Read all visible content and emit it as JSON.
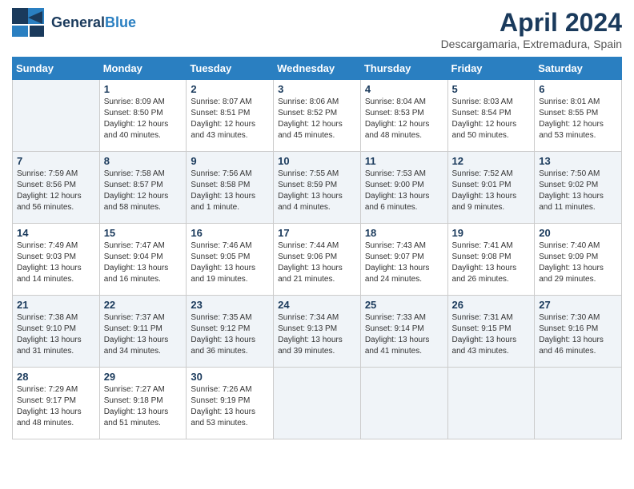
{
  "header": {
    "logo_general": "General",
    "logo_blue": "Blue",
    "title": "April 2024",
    "subtitle": "Descargamaria, Extremadura, Spain"
  },
  "columns": [
    "Sunday",
    "Monday",
    "Tuesday",
    "Wednesday",
    "Thursday",
    "Friday",
    "Saturday"
  ],
  "weeks": [
    [
      {
        "day": "",
        "sunrise": "",
        "sunset": "",
        "daylight": ""
      },
      {
        "day": "1",
        "sunrise": "Sunrise: 8:09 AM",
        "sunset": "Sunset: 8:50 PM",
        "daylight": "Daylight: 12 hours and 40 minutes."
      },
      {
        "day": "2",
        "sunrise": "Sunrise: 8:07 AM",
        "sunset": "Sunset: 8:51 PM",
        "daylight": "Daylight: 12 hours and 43 minutes."
      },
      {
        "day": "3",
        "sunrise": "Sunrise: 8:06 AM",
        "sunset": "Sunset: 8:52 PM",
        "daylight": "Daylight: 12 hours and 45 minutes."
      },
      {
        "day": "4",
        "sunrise": "Sunrise: 8:04 AM",
        "sunset": "Sunset: 8:53 PM",
        "daylight": "Daylight: 12 hours and 48 minutes."
      },
      {
        "day": "5",
        "sunrise": "Sunrise: 8:03 AM",
        "sunset": "Sunset: 8:54 PM",
        "daylight": "Daylight: 12 hours and 50 minutes."
      },
      {
        "day": "6",
        "sunrise": "Sunrise: 8:01 AM",
        "sunset": "Sunset: 8:55 PM",
        "daylight": "Daylight: 12 hours and 53 minutes."
      }
    ],
    [
      {
        "day": "7",
        "sunrise": "Sunrise: 7:59 AM",
        "sunset": "Sunset: 8:56 PM",
        "daylight": "Daylight: 12 hours and 56 minutes."
      },
      {
        "day": "8",
        "sunrise": "Sunrise: 7:58 AM",
        "sunset": "Sunset: 8:57 PM",
        "daylight": "Daylight: 12 hours and 58 minutes."
      },
      {
        "day": "9",
        "sunrise": "Sunrise: 7:56 AM",
        "sunset": "Sunset: 8:58 PM",
        "daylight": "Daylight: 13 hours and 1 minute."
      },
      {
        "day": "10",
        "sunrise": "Sunrise: 7:55 AM",
        "sunset": "Sunset: 8:59 PM",
        "daylight": "Daylight: 13 hours and 4 minutes."
      },
      {
        "day": "11",
        "sunrise": "Sunrise: 7:53 AM",
        "sunset": "Sunset: 9:00 PM",
        "daylight": "Daylight: 13 hours and 6 minutes."
      },
      {
        "day": "12",
        "sunrise": "Sunrise: 7:52 AM",
        "sunset": "Sunset: 9:01 PM",
        "daylight": "Daylight: 13 hours and 9 minutes."
      },
      {
        "day": "13",
        "sunrise": "Sunrise: 7:50 AM",
        "sunset": "Sunset: 9:02 PM",
        "daylight": "Daylight: 13 hours and 11 minutes."
      }
    ],
    [
      {
        "day": "14",
        "sunrise": "Sunrise: 7:49 AM",
        "sunset": "Sunset: 9:03 PM",
        "daylight": "Daylight: 13 hours and 14 minutes."
      },
      {
        "day": "15",
        "sunrise": "Sunrise: 7:47 AM",
        "sunset": "Sunset: 9:04 PM",
        "daylight": "Daylight: 13 hours and 16 minutes."
      },
      {
        "day": "16",
        "sunrise": "Sunrise: 7:46 AM",
        "sunset": "Sunset: 9:05 PM",
        "daylight": "Daylight: 13 hours and 19 minutes."
      },
      {
        "day": "17",
        "sunrise": "Sunrise: 7:44 AM",
        "sunset": "Sunset: 9:06 PM",
        "daylight": "Daylight: 13 hours and 21 minutes."
      },
      {
        "day": "18",
        "sunrise": "Sunrise: 7:43 AM",
        "sunset": "Sunset: 9:07 PM",
        "daylight": "Daylight: 13 hours and 24 minutes."
      },
      {
        "day": "19",
        "sunrise": "Sunrise: 7:41 AM",
        "sunset": "Sunset: 9:08 PM",
        "daylight": "Daylight: 13 hours and 26 minutes."
      },
      {
        "day": "20",
        "sunrise": "Sunrise: 7:40 AM",
        "sunset": "Sunset: 9:09 PM",
        "daylight": "Daylight: 13 hours and 29 minutes."
      }
    ],
    [
      {
        "day": "21",
        "sunrise": "Sunrise: 7:38 AM",
        "sunset": "Sunset: 9:10 PM",
        "daylight": "Daylight: 13 hours and 31 minutes."
      },
      {
        "day": "22",
        "sunrise": "Sunrise: 7:37 AM",
        "sunset": "Sunset: 9:11 PM",
        "daylight": "Daylight: 13 hours and 34 minutes."
      },
      {
        "day": "23",
        "sunrise": "Sunrise: 7:35 AM",
        "sunset": "Sunset: 9:12 PM",
        "daylight": "Daylight: 13 hours and 36 minutes."
      },
      {
        "day": "24",
        "sunrise": "Sunrise: 7:34 AM",
        "sunset": "Sunset: 9:13 PM",
        "daylight": "Daylight: 13 hours and 39 minutes."
      },
      {
        "day": "25",
        "sunrise": "Sunrise: 7:33 AM",
        "sunset": "Sunset: 9:14 PM",
        "daylight": "Daylight: 13 hours and 41 minutes."
      },
      {
        "day": "26",
        "sunrise": "Sunrise: 7:31 AM",
        "sunset": "Sunset: 9:15 PM",
        "daylight": "Daylight: 13 hours and 43 minutes."
      },
      {
        "day": "27",
        "sunrise": "Sunrise: 7:30 AM",
        "sunset": "Sunset: 9:16 PM",
        "daylight": "Daylight: 13 hours and 46 minutes."
      }
    ],
    [
      {
        "day": "28",
        "sunrise": "Sunrise: 7:29 AM",
        "sunset": "Sunset: 9:17 PM",
        "daylight": "Daylight: 13 hours and 48 minutes."
      },
      {
        "day": "29",
        "sunrise": "Sunrise: 7:27 AM",
        "sunset": "Sunset: 9:18 PM",
        "daylight": "Daylight: 13 hours and 51 minutes."
      },
      {
        "day": "30",
        "sunrise": "Sunrise: 7:26 AM",
        "sunset": "Sunset: 9:19 PM",
        "daylight": "Daylight: 13 hours and 53 minutes."
      },
      {
        "day": "",
        "sunrise": "",
        "sunset": "",
        "daylight": ""
      },
      {
        "day": "",
        "sunrise": "",
        "sunset": "",
        "daylight": ""
      },
      {
        "day": "",
        "sunrise": "",
        "sunset": "",
        "daylight": ""
      },
      {
        "day": "",
        "sunrise": "",
        "sunset": "",
        "daylight": ""
      }
    ]
  ]
}
